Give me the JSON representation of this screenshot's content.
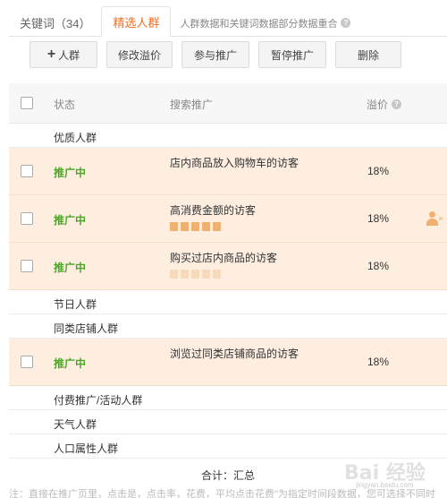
{
  "tabs": [
    {
      "label": "关键词（34）",
      "active": false
    },
    {
      "label": "精选人群",
      "active": true
    }
  ],
  "tab_note": "人群数据和关键词数据部分数据重合",
  "toolbar": {
    "add_label": "人群",
    "modify_label": "修改溢价",
    "join_label": "参与推广",
    "pause_label": "暂停推广",
    "delete_label": "删除"
  },
  "table": {
    "headers": {
      "status": "状态",
      "search": "搜索推广",
      "premium": "溢价"
    },
    "groups": {
      "quality": "优质人群",
      "holiday": "节日人群",
      "similar_store": "同类店铺人群",
      "paid_promo": "付费推广/活动人群",
      "weather": "天气人群",
      "demographic": "人口属性人群"
    },
    "rows": [
      {
        "status": "推广中",
        "crowd": "店内商品放入购物车的访客",
        "premium": "18%"
      },
      {
        "status": "推广中",
        "crowd": "高消费金额的访客",
        "premium": "18%"
      },
      {
        "status": "推广中",
        "crowd": "购买过店内商品的访客",
        "premium": "18%"
      },
      {
        "status": "推广中",
        "crowd": "浏览过同类店铺商品的访客",
        "premium": "18%"
      }
    ]
  },
  "total": "合计：汇总",
  "footnote": "注：直接在推广页里，点击是，点击率，花费，平均点击花费\"为指定时间段数据，您可选择不同时",
  "watermark": "Bai 经验",
  "watermark_sub": "jingyan.baidu.com",
  "colors": {
    "accent": "#f07020",
    "status_green": "#4fa52a",
    "row_highlight": "#fdeee0"
  }
}
